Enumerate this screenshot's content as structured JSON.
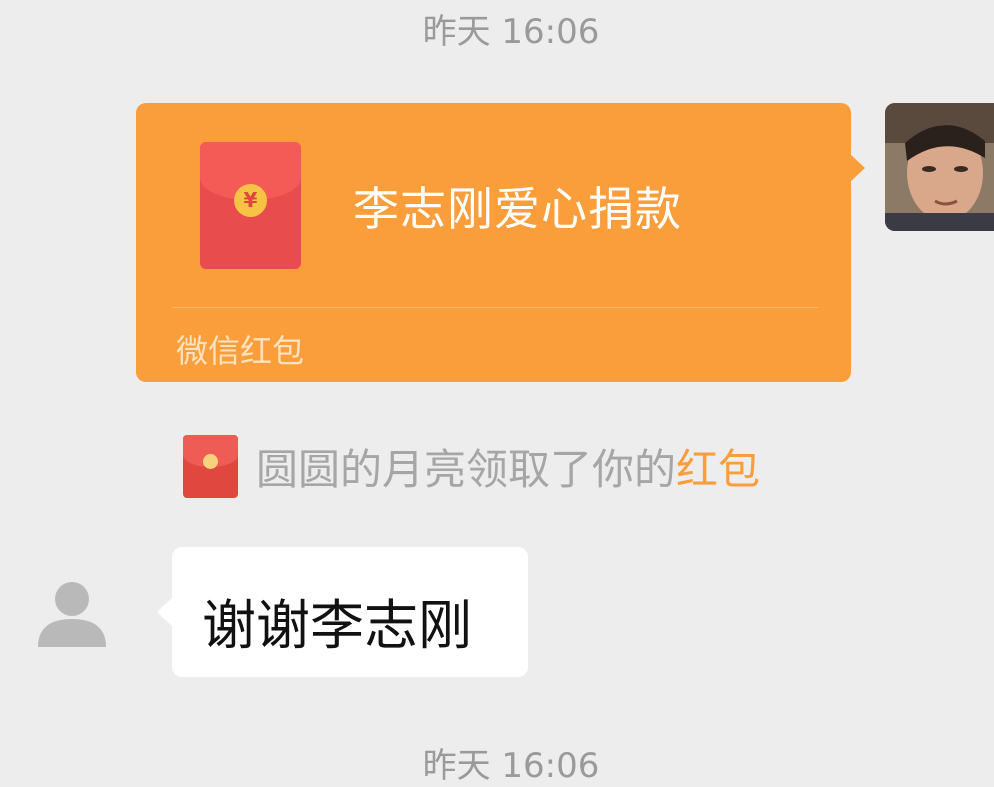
{
  "chat": {
    "timestamp_top": "昨天 16:06",
    "timestamp_bottom": "昨天 16:06"
  },
  "red_packet": {
    "title": "李志刚爱心捐款",
    "footer": "微信红包",
    "currency_symbol": "¥",
    "card_color": "#fa9d3b",
    "envelope_color": "#e84c4c"
  },
  "notice": {
    "text": "圆圆的月亮领取了你的",
    "link": "红包",
    "link_color": "#fa9d3b"
  },
  "incoming_message": {
    "text": "谢谢李志刚"
  },
  "avatars": {
    "sender": "photo-avatar",
    "receiver": "default-person-icon"
  }
}
